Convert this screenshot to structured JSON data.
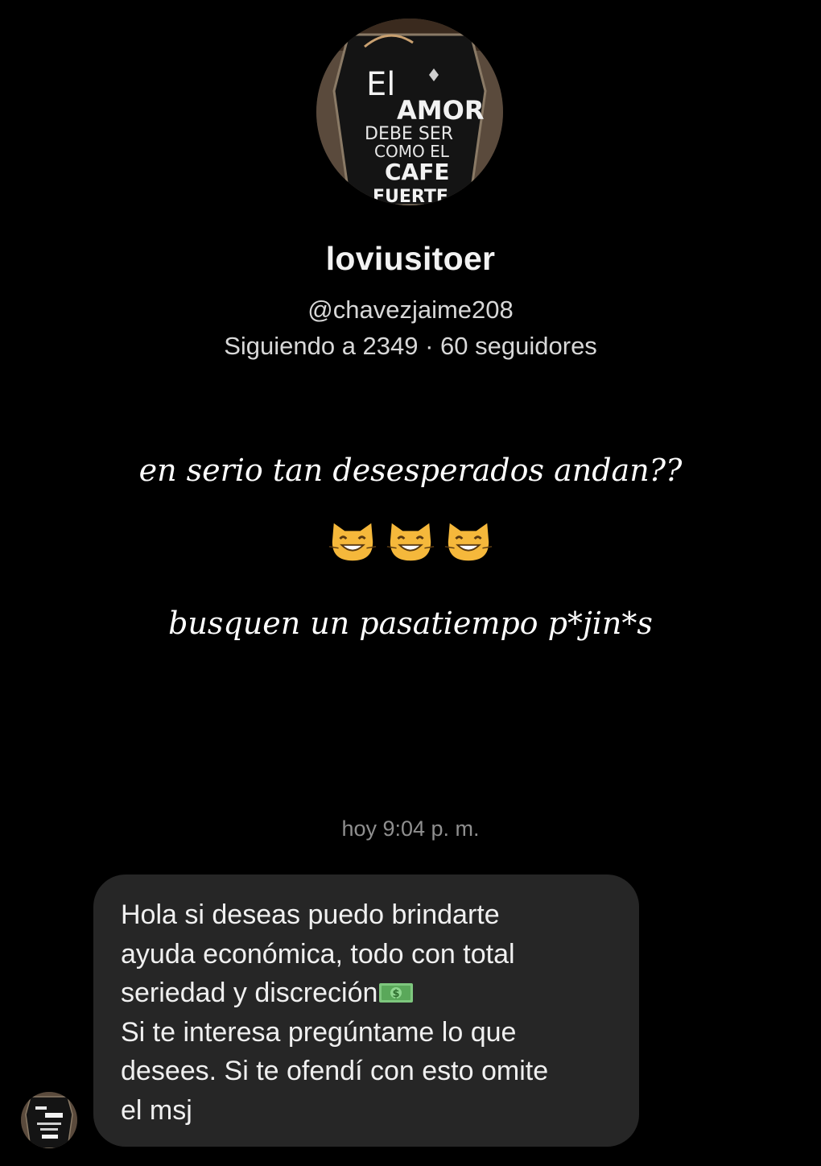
{
  "profile": {
    "avatar_icon": "profile-avatar-chalkboard-icon",
    "avatar_text": [
      "El",
      "AMOR",
      "DEBE SER",
      "COMO EL",
      "CAFE",
      "FUERTE"
    ],
    "name": "loviusitoer",
    "handle": "@chavezjaime208",
    "stats": "Siguiendo a 2349 · 60 seguidores"
  },
  "bio": {
    "line1": "en serio tan desesperados andan??",
    "emojis": [
      "grinning-cat-icon",
      "grinning-cat-icon",
      "grinning-cat-icon"
    ],
    "line3": "busquen un pasatiempo p*jin*s"
  },
  "chat": {
    "timestamp": "hoy 9:04 p. m.",
    "message_lines": [
      "Hola si deseas puedo brindarte",
      "ayuda económica, todo con total",
      "seriedad y discreción",
      "Si te interesa pregúntame lo que",
      "desees. Si te ofendí con esto omite",
      "el msj"
    ],
    "money_icon": "dollar-banknote-icon",
    "sender_avatar_icon": "sender-avatar-icon"
  },
  "colors": {
    "background": "#000000",
    "bubble": "#262626",
    "timestamp": "#8f8f8f"
  }
}
